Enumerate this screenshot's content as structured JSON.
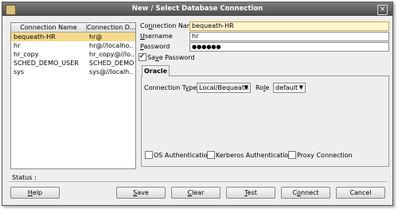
{
  "window": {
    "title": "New / Select Database Connection"
  },
  "connections": {
    "columns": [
      "Connection Name",
      "Connection D..."
    ],
    "rows": [
      {
        "name": "bequeath-HR",
        "details": "hr@"
      },
      {
        "name": "hr",
        "details": "hr@//localho..."
      },
      {
        "name": "hr_copy",
        "details": "hr_copy@//lo..."
      },
      {
        "name": "SCHED_DEMO_USER",
        "details": "SCHED_DEMO..."
      },
      {
        "name": "sys",
        "details": "sys@//localh..."
      }
    ],
    "selected_index": 0
  },
  "form": {
    "connection_name_label_pre": "Co",
    "connection_name_label_key": "n",
    "connection_name_label_post": "nection Name",
    "connection_name_value": "bequeath-HR",
    "username_label_key": "U",
    "username_label_post": "sername",
    "username_value": "hr",
    "password_label_key": "P",
    "password_label_post": "assword",
    "password_value": "●●●●●●",
    "save_password_pre": "Sa",
    "save_password_key": "v",
    "save_password_post": "e Password",
    "save_password_checked": true
  },
  "tabs": {
    "oracle": "Oracle"
  },
  "oracle": {
    "connection_type_pre": "Connection T",
    "connection_type_key": "y",
    "connection_type_post": "pe",
    "connection_type_value": "Local/Bequeath",
    "role_pre": "Ro",
    "role_key": "l",
    "role_post": "e",
    "role_value": "default",
    "os_auth_label": "OS Authentication",
    "kerberos_label": "Kerberos Authentication",
    "proxy_label": "Proxy Connection"
  },
  "status_label": "Status :",
  "buttons": {
    "help_key": "H",
    "help_post": "elp",
    "save_key": "S",
    "save_post": "ave",
    "clear_key": "C",
    "clear_post": "lear",
    "test_key": "T",
    "test_post": "est",
    "connect_pre": "C",
    "connect_key": "o",
    "connect_post": "nnect",
    "cancel": "Cancel"
  },
  "colors": {
    "selection": "#f6d98a",
    "titlebar": "#5a5a5a",
    "focus_field": "#fff6d0"
  }
}
